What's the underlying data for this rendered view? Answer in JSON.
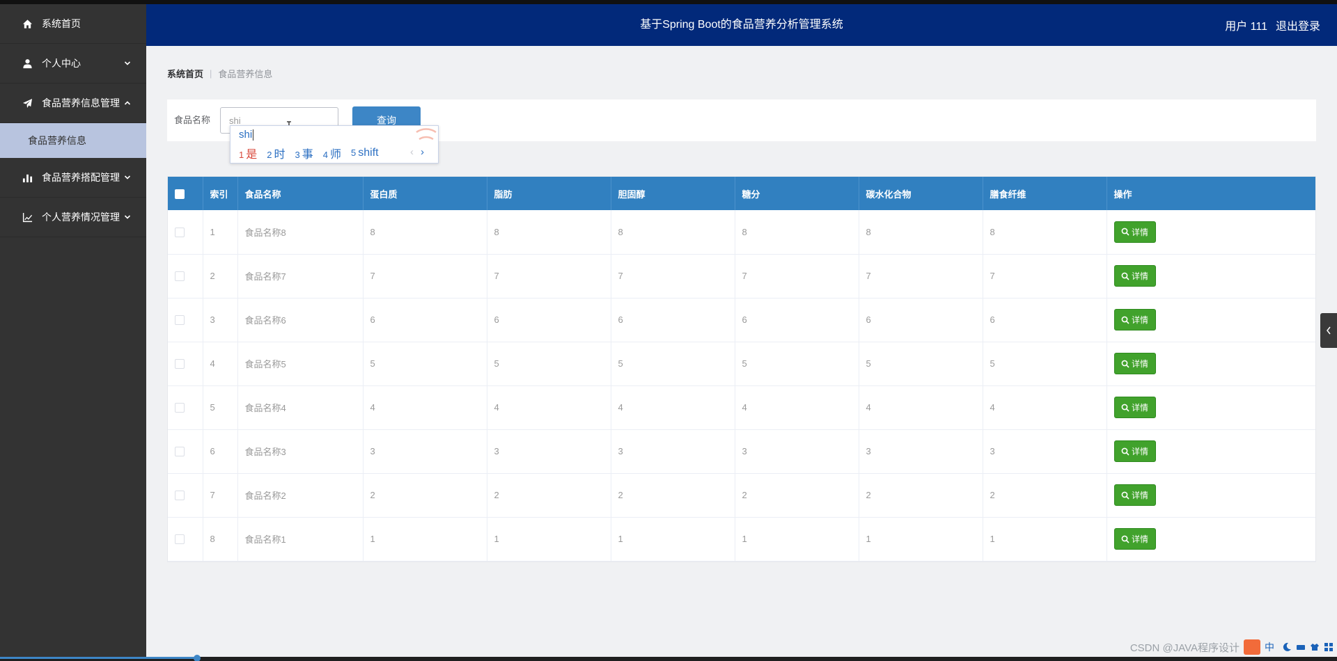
{
  "app": {
    "title": "基于Spring Boot的食品营养分析管理系统"
  },
  "header": {
    "user_label": "用户 111",
    "logout_label": "退出登录"
  },
  "sidebar": {
    "items": [
      {
        "label": "系统首页",
        "icon": "home-icon"
      },
      {
        "label": "个人中心",
        "icon": "user-icon"
      },
      {
        "label": "食品营养信息管理",
        "icon": "paper-plane-icon"
      },
      {
        "label": "食品营养搭配管理",
        "icon": "bar-chart-icon"
      },
      {
        "label": "个人营养情况管理",
        "icon": "line-chart-icon"
      }
    ],
    "submenu": {
      "label": "食品营养信息"
    }
  },
  "breadcrumb": {
    "home": "系统首页",
    "separator": "|",
    "current": "食品营养信息"
  },
  "search": {
    "label": "食品名称",
    "value": "shi",
    "button_label": "查询"
  },
  "ime": {
    "composition": "shi",
    "candidates": [
      {
        "num": "1",
        "text": "是"
      },
      {
        "num": "2",
        "text": "时"
      },
      {
        "num": "3",
        "text": "事"
      },
      {
        "num": "4",
        "text": "师"
      },
      {
        "num": "5",
        "text": "shift"
      }
    ],
    "prev": "‹",
    "next": "›"
  },
  "table": {
    "headers": [
      "",
      "索引",
      "食品名称",
      "蛋白质",
      "脂肪",
      "胆固醇",
      "糖分",
      "碳水化合物",
      "膳食纤维",
      "操作"
    ],
    "action_label": "详情",
    "rows": [
      [
        "1",
        "食品名称8",
        "8",
        "8",
        "8",
        "8",
        "8",
        "8"
      ],
      [
        "2",
        "食品名称7",
        "7",
        "7",
        "7",
        "7",
        "7",
        "7"
      ],
      [
        "3",
        "食品名称6",
        "6",
        "6",
        "6",
        "6",
        "6",
        "6"
      ],
      [
        "4",
        "食品名称5",
        "5",
        "5",
        "5",
        "5",
        "5",
        "5"
      ],
      [
        "5",
        "食品名称4",
        "4",
        "4",
        "4",
        "4",
        "4",
        "4"
      ],
      [
        "6",
        "食品名称3",
        "3",
        "3",
        "3",
        "3",
        "3",
        "3"
      ],
      [
        "7",
        "食品名称2",
        "2",
        "2",
        "2",
        "2",
        "2",
        "2"
      ],
      [
        "8",
        "食品名称1",
        "1",
        "1",
        "1",
        "1",
        "1",
        "1"
      ]
    ]
  },
  "tray": {
    "watermark": "CSDN @JAVA程序设计",
    "ime_indicator": "中"
  },
  "colors": {
    "header_bg": "#02297a",
    "sidebar_bg": "#333333",
    "submenu_active_bg": "#b8c4df",
    "table_head_bg": "#3180c0",
    "search_button": "#3d86c6",
    "detail_button": "#41a22c"
  }
}
